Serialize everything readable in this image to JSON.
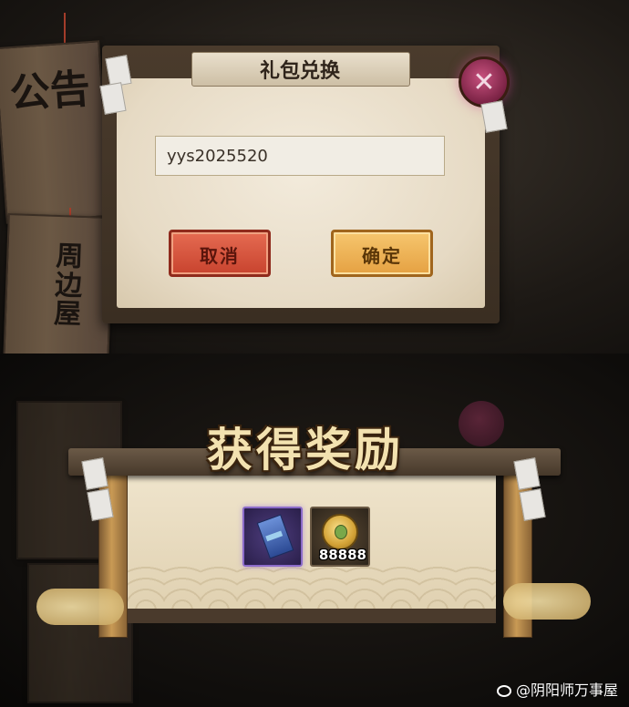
{
  "gift_code_dialog": {
    "title": "礼包兑换",
    "code_input_value": "yys2025520",
    "cancel_label": "取消",
    "confirm_label": "确定",
    "close_symbol": "✕"
  },
  "side_boards": {
    "notice_label": "公告",
    "shop_label": "周边屋"
  },
  "reward_dialog": {
    "title": "获得奖励",
    "items": [
      {
        "icon": "ticket-icon",
        "quantity": ""
      },
      {
        "icon": "coin-icon",
        "quantity": "88888"
      }
    ]
  },
  "watermark": "@阴阳师万事屋",
  "colors": {
    "cancel_button": "#d9573f",
    "confirm_button": "#f0b45a",
    "close_button": "#a8386a",
    "title_gold": "#f3e2b0"
  }
}
